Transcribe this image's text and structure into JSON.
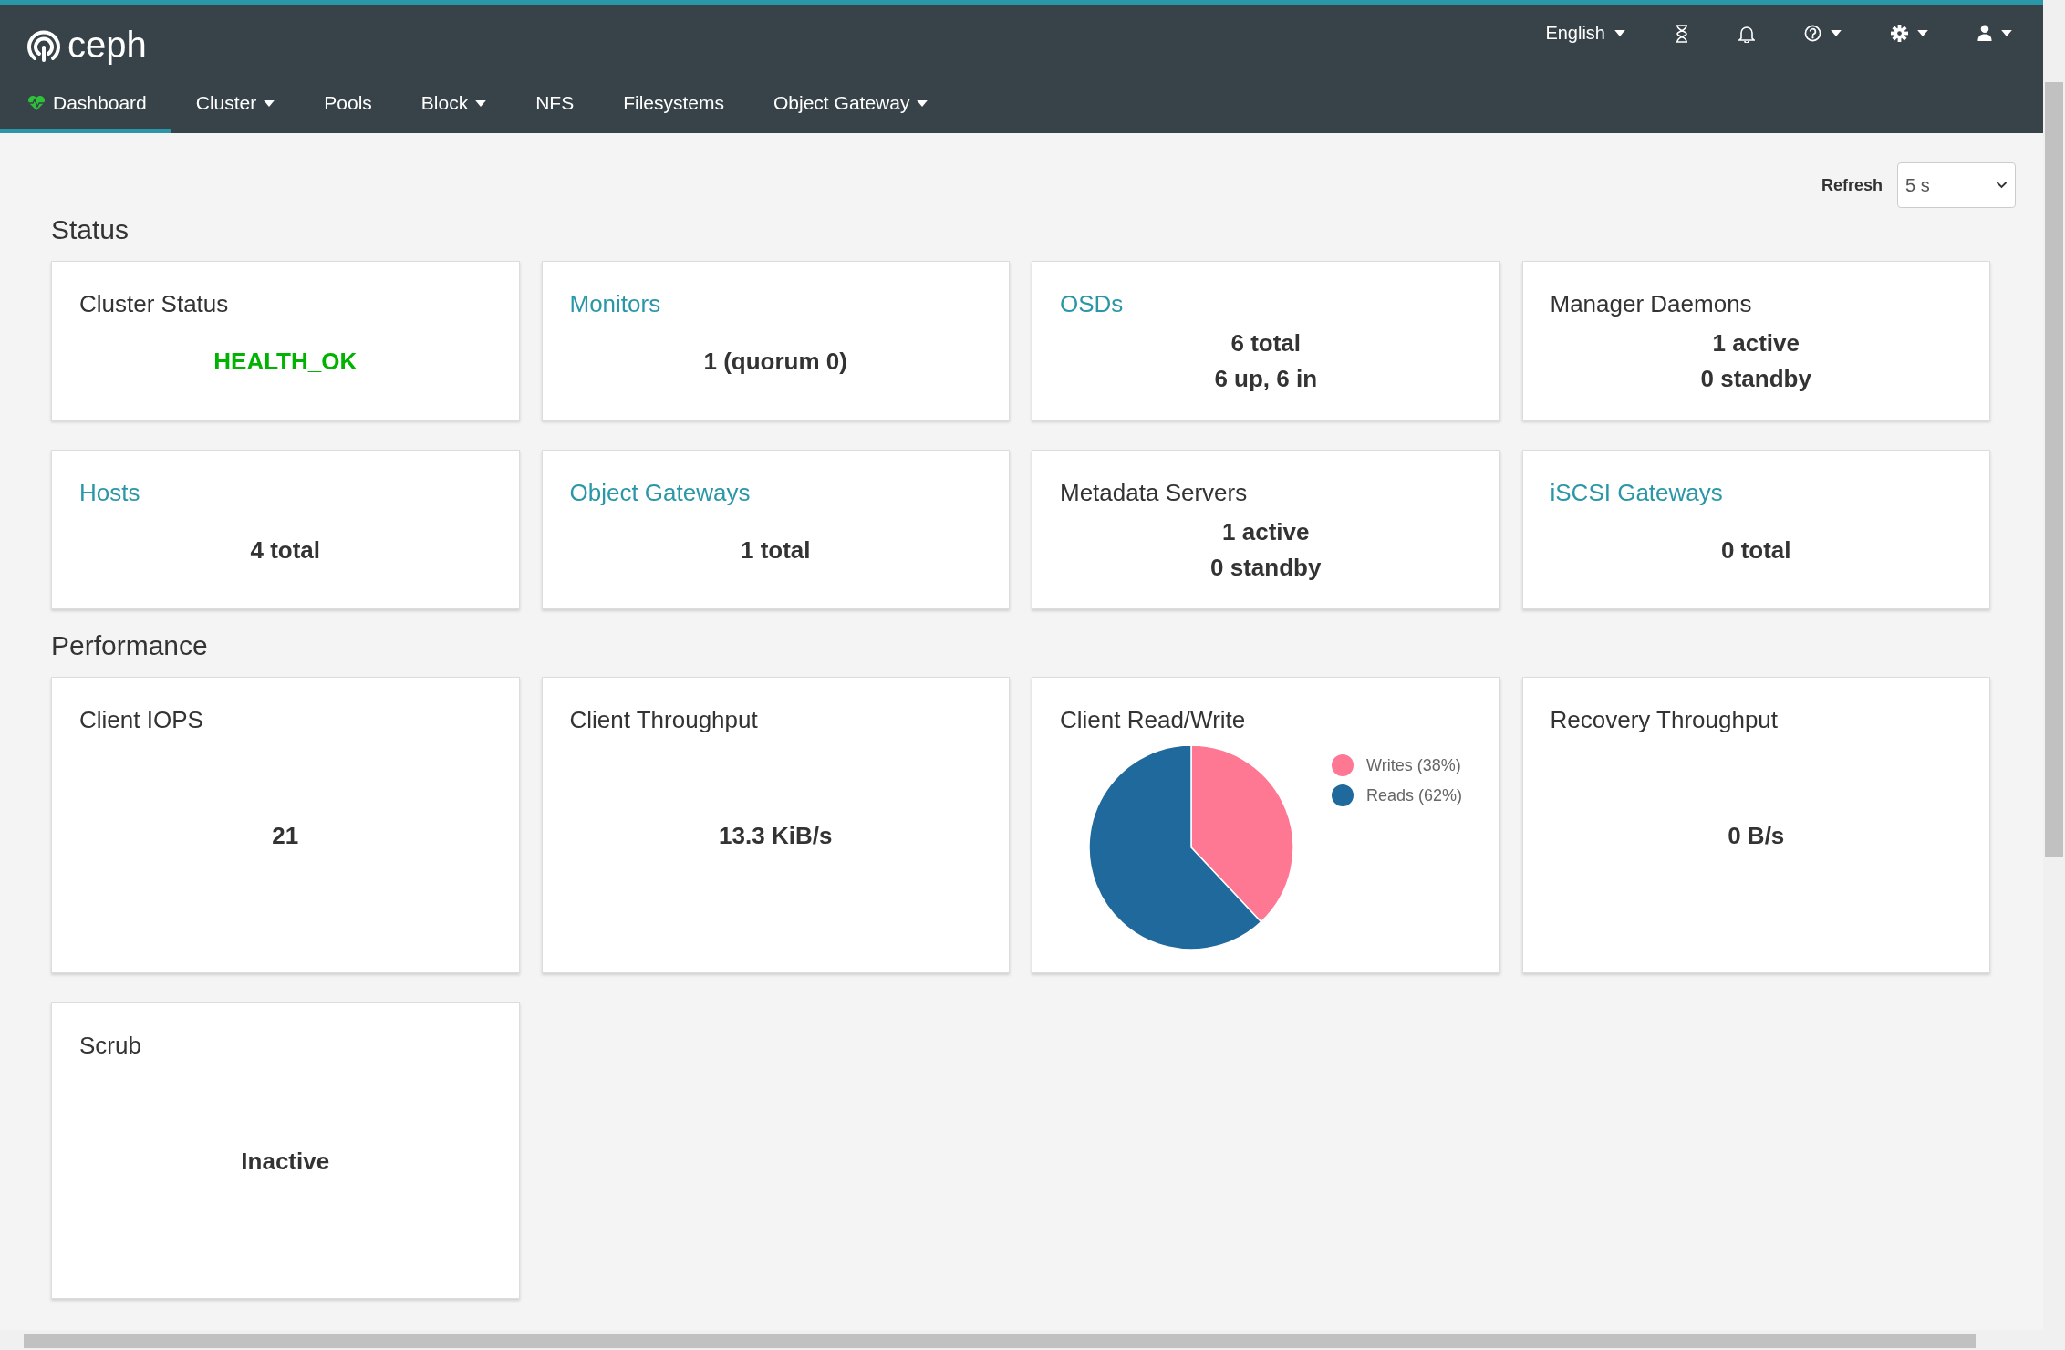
{
  "header": {
    "brand": "ceph",
    "language": "English",
    "nav": [
      {
        "label": "Dashboard",
        "selected": true,
        "dropdown": false
      },
      {
        "label": "Cluster",
        "selected": false,
        "dropdown": true
      },
      {
        "label": "Pools",
        "selected": false,
        "dropdown": false
      },
      {
        "label": "Block",
        "selected": false,
        "dropdown": true
      },
      {
        "label": "NFS",
        "selected": false,
        "dropdown": false
      },
      {
        "label": "Filesystems",
        "selected": false,
        "dropdown": false
      },
      {
        "label": "Object Gateway",
        "selected": false,
        "dropdown": true
      }
    ]
  },
  "refresh": {
    "label": "Refresh",
    "value": "5 s"
  },
  "sections": [
    {
      "title": "Status",
      "cards": [
        {
          "kind": "text",
          "title": "Cluster Status",
          "link": false,
          "lines": [
            "HEALTH_OK"
          ],
          "ok": true
        },
        {
          "kind": "text",
          "title": "Monitors",
          "link": true,
          "lines": [
            "1 (quorum 0)"
          ]
        },
        {
          "kind": "text",
          "title": "OSDs",
          "link": true,
          "lines": [
            "6 total",
            "6 up, 6 in"
          ]
        },
        {
          "kind": "text",
          "title": "Manager Daemons",
          "link": false,
          "lines": [
            "1 active",
            "0 standby"
          ]
        },
        {
          "kind": "text",
          "title": "Hosts",
          "link": true,
          "lines": [
            "4 total"
          ]
        },
        {
          "kind": "text",
          "title": "Object Gateways",
          "link": true,
          "lines": [
            "1 total"
          ]
        },
        {
          "kind": "text",
          "title": "Metadata Servers",
          "link": false,
          "lines": [
            "1 active",
            "0 standby"
          ]
        },
        {
          "kind": "text",
          "title": "iSCSI Gateways",
          "link": true,
          "lines": [
            "0 total"
          ]
        }
      ]
    },
    {
      "title": "Performance",
      "cards": [
        {
          "kind": "text",
          "title": "Client IOPS",
          "link": false,
          "lines": [
            "21"
          ]
        },
        {
          "kind": "text",
          "title": "Client Throughput",
          "link": false,
          "lines": [
            "13.3 KiB/s"
          ]
        },
        {
          "kind": "pie",
          "title": "Client Read/Write",
          "link": false,
          "slices": [
            {
              "color": "#ff7893"
            },
            {
              "color": "#1f699c"
            }
          ],
          "chart_data": {
            "type": "pie",
            "categories": [
              "Writes (38%)",
              "Reads (62%)"
            ],
            "values": [
              38,
              62
            ],
            "legend": "right"
          }
        },
        {
          "kind": "text",
          "title": "Recovery Throughput",
          "link": false,
          "lines": [
            "0 B/s"
          ]
        },
        {
          "kind": "text",
          "title": "Scrub",
          "link": false,
          "lines": [
            "Inactive"
          ]
        }
      ]
    }
  ]
}
